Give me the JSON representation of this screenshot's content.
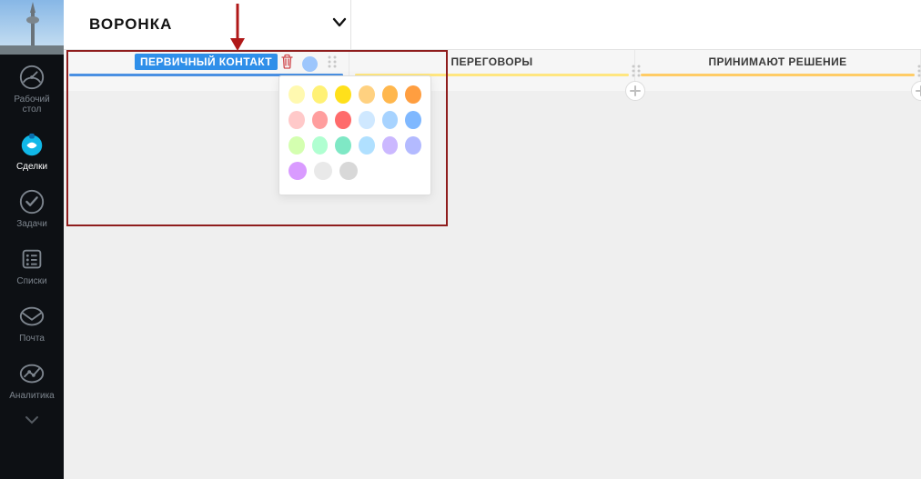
{
  "sidebar": {
    "items": [
      {
        "label": "Рабочий\nстол"
      },
      {
        "label": "Сделки"
      },
      {
        "label": "Задачи"
      },
      {
        "label": "Списки"
      },
      {
        "label": "Почта"
      },
      {
        "label": "Аналитика"
      }
    ]
  },
  "header": {
    "title": "ВОРОНКА"
  },
  "stages": [
    {
      "name": "ПЕРВИЧНЫЙ КОНТАКТ",
      "underline": "#4a90e2",
      "selected": true,
      "showAdd": false,
      "showDrag": false,
      "showEditTools": true
    },
    {
      "name": "ПЕРЕГОВОРЫ",
      "underline": "#ffe680",
      "selected": false,
      "showAdd": true,
      "showDrag": true,
      "showEditTools": false
    },
    {
      "name": "ПРИНИМАЮТ РЕШЕНИЕ",
      "underline": "#ffcc66",
      "selected": false,
      "showAdd": true,
      "showDrag": true,
      "showEditTools": false
    }
  ],
  "color_picker": {
    "current": "#9dc6fc",
    "rows": [
      [
        "#fff9b0",
        "#fff176",
        "#ffe01b",
        "#ffd180",
        "#ffb74d",
        "#ff9e40"
      ],
      [
        "#ffc9c9",
        "#ff9e9e",
        "#ff6b6b",
        "#cfe8ff",
        "#a7d3ff",
        "#7fb8ff"
      ],
      [
        "#d4ffb0",
        "#b0ffd1",
        "#7fe8c5",
        "#b0e0ff",
        "#cbb8ff",
        "#b3baff"
      ],
      [
        "#d99bff",
        "#e9e9e9",
        "#d8d8d8"
      ]
    ]
  }
}
